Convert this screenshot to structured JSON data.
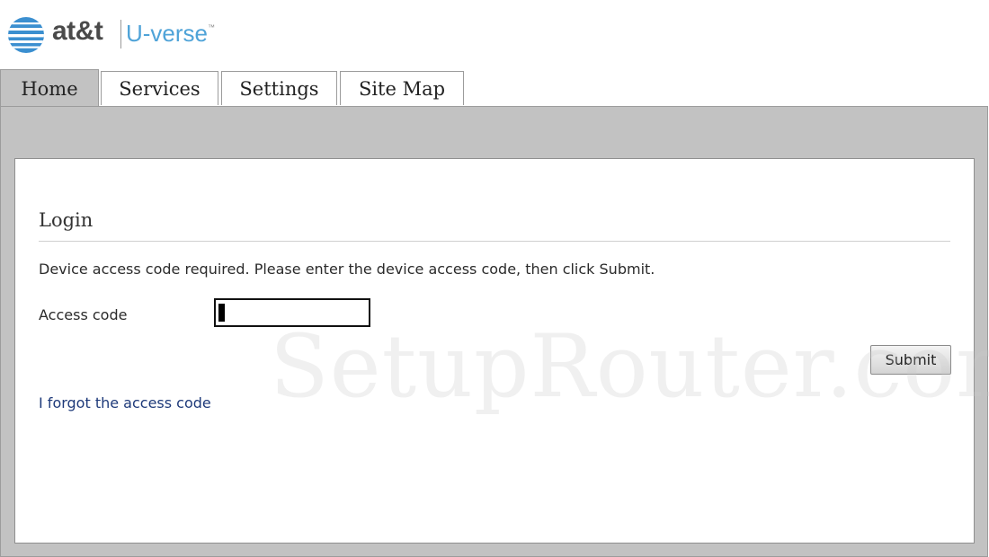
{
  "header": {
    "brand": "at&t",
    "product": "U-verse",
    "trademark": "™",
    "logo_icon": "att-globe-icon"
  },
  "tabs": [
    {
      "label": "Home",
      "active": true
    },
    {
      "label": "Services",
      "active": false
    },
    {
      "label": "Settings",
      "active": false
    },
    {
      "label": "Site Map",
      "active": false
    }
  ],
  "login": {
    "title": "Login",
    "instructions": "Device access code required. Please enter the device access code, then click Submit.",
    "access_code_label": "Access code",
    "access_code_value": "",
    "submit_label": "Submit",
    "forgot_link": "I forgot the access code"
  },
  "watermark": "SetupRouter.com",
  "colors": {
    "tab_active": "#c2c2c2",
    "frame": "#c2c2c2",
    "link": "#1e3a7a",
    "brand_blue": "#4fa3d8"
  }
}
